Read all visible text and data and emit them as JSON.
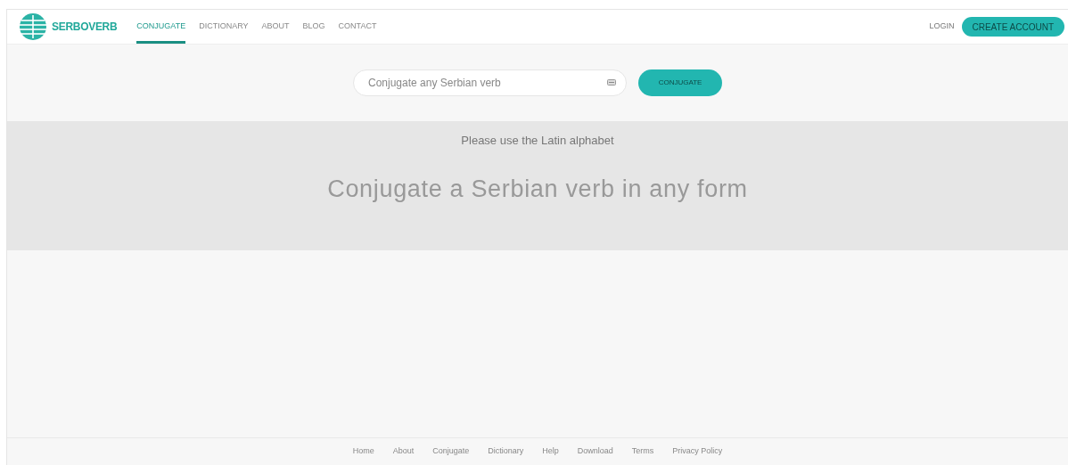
{
  "brand": "SERBOVERB",
  "nav": [
    {
      "label": "CONJUGATE",
      "selected": true
    },
    {
      "label": "DICTIONARY",
      "selected": false
    },
    {
      "label": "ABOUT",
      "selected": false
    },
    {
      "label": "BLOG",
      "selected": false
    },
    {
      "label": "CONTACT",
      "selected": false
    }
  ],
  "login": "LOGIN",
  "create_account": "CREATE ACCOUNT",
  "search": {
    "placeholder": "Conjugate any Serbian verb"
  },
  "conjugate_button": "CONJUGATE",
  "hint": "Please use the Latin alphabet",
  "headline": "Conjugate a Serbian verb in any form",
  "footer_links": [
    "Home",
    "About",
    "Conjugate",
    "Dictionary",
    "Help",
    "Download",
    "Terms",
    "Privacy Policy"
  ]
}
